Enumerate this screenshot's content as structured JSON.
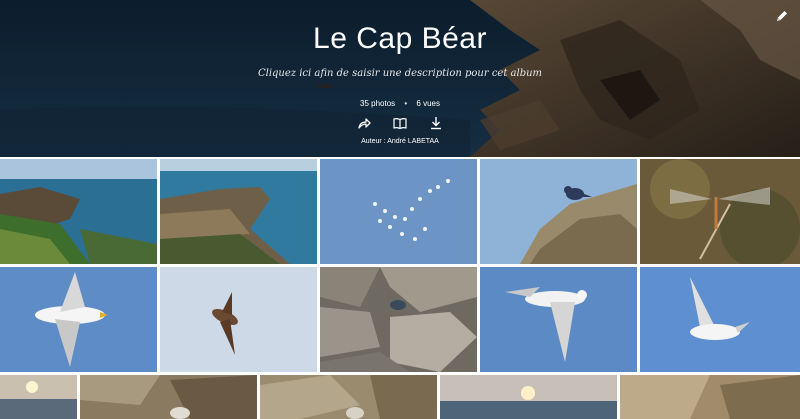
{
  "album": {
    "title": "Le Cap Béar",
    "description_placeholder": "Cliquez ici afin de saisir une description pour cet album",
    "photos_count": "35 photos",
    "views_count": "6 vues",
    "author": "Auteur : André LABETAA"
  },
  "icons": {
    "edit": "pencil-icon",
    "share": "share-icon",
    "book": "book-icon",
    "download": "download-icon"
  },
  "photos": [
    {
      "subject": "coastline cliffs with vegetation"
    },
    {
      "subject": "rocky headland over sea"
    },
    {
      "subject": "flock of birds in blue sky"
    },
    {
      "subject": "blue rock thrush on rock"
    },
    {
      "subject": "dragonfly on twig"
    },
    {
      "subject": "gull in flight"
    },
    {
      "subject": "crag martin in flight"
    },
    {
      "subject": "rocks with small bird"
    },
    {
      "subject": "gull in flight"
    },
    {
      "subject": "gull in flight"
    },
    {
      "subject": "sunset over sea"
    },
    {
      "subject": "rocks close-up"
    },
    {
      "subject": "rocks close-up"
    },
    {
      "subject": "sunset over sea"
    },
    {
      "subject": "rocks close-up"
    }
  ]
}
